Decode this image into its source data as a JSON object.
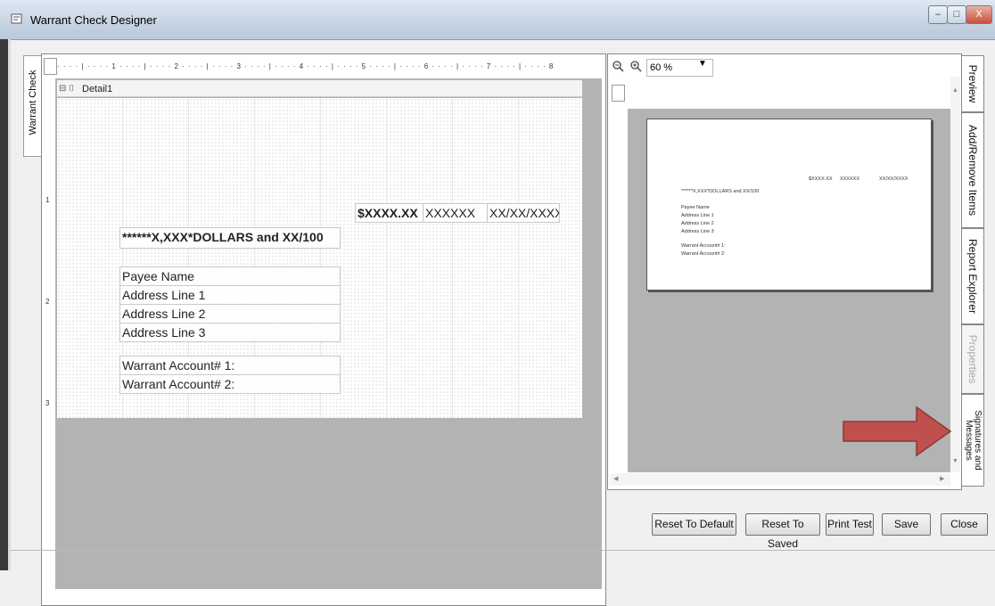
{
  "window": {
    "title": "Warrant Check Designer",
    "min": "–",
    "max": "□",
    "close": "X"
  },
  "designer": {
    "side_tab": "Warrant Check",
    "band_label": "Detail1",
    "ruler": "· · · · | · · · · 1 · · · · | · · · · 2 · · · · | · · · · 3 · · · · | · · · · 4 · · · · | · · · · 5 · · · · | · · · · 6 · · · · | · · · · 7 · · · · | · · · · 8",
    "ruler_v": [
      "1",
      "2",
      "3"
    ],
    "fields": {
      "amount": "$XXXX.XX",
      "check_no": "XXXXXX",
      "date": "XX/XX/XXXX",
      "dollars_text": "******X,XXX*DOLLARS and XX/100",
      "payee": "Payee Name",
      "addr1": "Address Line 1",
      "addr2": "Address Line 2",
      "addr3": "Address Line 3",
      "acct1": "Warrant Account# 1:",
      "acct2": "Warrant Account# 2:"
    }
  },
  "preview": {
    "zoom": "60 %",
    "page": {
      "amount": "$XXXX.XX",
      "check_no": "XXXXXX",
      "date": "XX/XX/XXXX",
      "dollars_text": "******X,XXX*DOLLARS and XX/100",
      "payee": "Payee Name",
      "addr1": "Address Line 1",
      "addr2": "Address Line 2",
      "addr3": "Address Line 3",
      "acct1": "Warrant Account# 1:",
      "acct2": "Warrant Account# 2:"
    }
  },
  "right_tabs": [
    "Preview",
    "Add/Remove Items",
    "Report Explorer",
    "Properties",
    "Signatures and Messages"
  ],
  "buttons": {
    "reset_default": "Reset To Default",
    "reset_saved": "Reset To Saved",
    "print_test": "Print Test",
    "save": "Save",
    "close": "Close"
  },
  "colors": {
    "arrow": "#c0504d",
    "canvas_gray": "#b3b3b3"
  }
}
